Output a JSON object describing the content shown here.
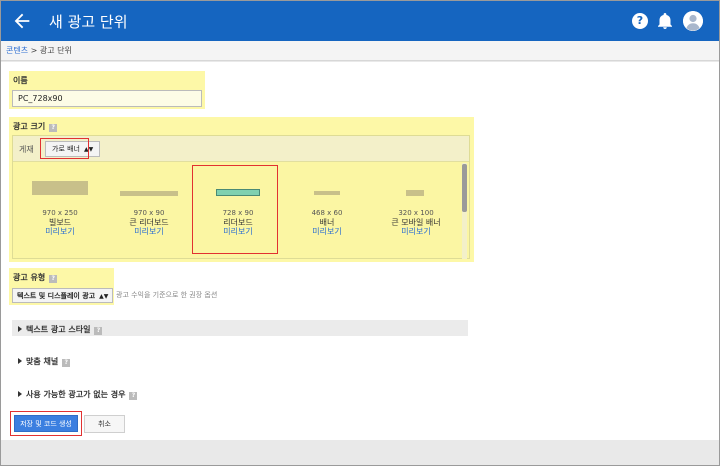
{
  "header": {
    "title": "새 광고 단위"
  },
  "breadcrumb": {
    "link": "콘텐츠",
    "separator": ">",
    "current": "광고 단위"
  },
  "name_section": {
    "label": "이름",
    "value": "PC_728x90"
  },
  "size_section": {
    "label": "광고 크기",
    "help": "?",
    "placement_label": "게재",
    "placement_select": "가로 배너",
    "sizes": [
      {
        "dims": "970 x 250",
        "name": "빌보드",
        "preview": "미리보기",
        "selected": false
      },
      {
        "dims": "970 x 90",
        "name": "큰 리더보드",
        "preview": "미리보기",
        "selected": false
      },
      {
        "dims": "728 x 90",
        "name": "리더보드",
        "preview": "미리보기",
        "selected": true
      },
      {
        "dims": "468 x 60",
        "name": "배너",
        "preview": "미리보기",
        "selected": false
      },
      {
        "dims": "320 x 100",
        "name": "큰 모바일 배너",
        "preview": "미리보기",
        "selected": false
      }
    ]
  },
  "type_section": {
    "label": "광고 유형",
    "help": "?",
    "select": "텍스트 및 디스플레이 광고",
    "note": "광고 수익을 기준으로 한 권장 옵션"
  },
  "collapsibles": [
    {
      "label": "텍스트 광고 스타일",
      "help": "?"
    },
    {
      "label": "맞춤 채널",
      "help": "?"
    },
    {
      "label": "사용 가능한 광고가 없는 경우",
      "help": "?"
    }
  ],
  "actions": {
    "save": "저장 및 코드 생성",
    "cancel": "취소"
  },
  "colors": {
    "topbar": "#1565c0",
    "highlight": "#fdf8a7",
    "selected_outline": "#e23131",
    "primary_button": "#3b7fe0",
    "selected_size_bar": "#7fd1b0"
  }
}
